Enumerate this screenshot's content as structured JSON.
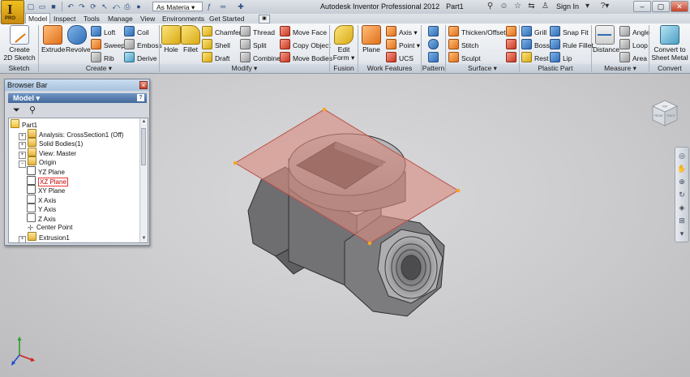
{
  "app": {
    "logo_text": "I",
    "logo_sub": "PRO",
    "title": "Autodesk Inventor Professional 2012",
    "document": "Part1",
    "material_dropdown": "As Materia",
    "sign_in": "Sign In"
  },
  "icons": {
    "qat": [
      "new-icon",
      "open-icon",
      "save-icon",
      "undo-icon",
      "redo-icon",
      "update-icon",
      "select-icon",
      "return-icon",
      "print-icon"
    ],
    "help": [
      "binoculars-icon",
      "people-icon",
      "star-icon",
      "exchange-icon",
      "help-icon"
    ]
  },
  "tabs": [
    "Model",
    "Inspect",
    "Tools",
    "Manage",
    "View",
    "Environments",
    "Get Started"
  ],
  "ribbon": {
    "panels": [
      "Sketch",
      "Create ▾",
      "Modify ▾",
      "Fusion",
      "Work Features",
      "Pattern",
      "Surface ▾",
      "Plastic Part",
      "Measure ▾",
      "Convert"
    ],
    "sketch": {
      "create_2d_sketch": "Create\n2D Sketch ▾"
    },
    "create": {
      "extrude": "Extrude",
      "revolve": "Revolve",
      "loft": "Loft",
      "sweep": "Sweep",
      "rib": "Rib",
      "coil": "Coil",
      "emboss": "Emboss",
      "derive": "Derive"
    },
    "modify": {
      "hole": "Hole",
      "fillet": "Fillet",
      "chamfer": "Chamfer",
      "shell": "Shell",
      "draft": "Draft",
      "thread": "Thread",
      "split": "Split",
      "combine": "Combine",
      "move_face": "Move Face",
      "copy_object": "Copy Object",
      "move_bodies": "Move Bodies"
    },
    "fusion": {
      "edit_form": "Edit\nForm ▾"
    },
    "work_features": {
      "plane": "Plane",
      "axis": "Axis ▾",
      "point": "Point ▾",
      "ucs": "UCS"
    },
    "surface": {
      "thicken_offset": "Thicken/Offset",
      "stitch": "Stitch",
      "sculpt": "Sculpt"
    },
    "plastic_part": {
      "grill": "Grill",
      "boss": "Boss",
      "rest": "Rest",
      "snap_fit": "Snap Fit",
      "rule_fillet": "Rule Fillet",
      "lip": "Lip"
    },
    "measure": {
      "distance": "Distance",
      "angle": "Angle",
      "loop": "Loop",
      "area": "Area"
    },
    "convert": {
      "sheet_metal": "Convert to\nSheet Metal"
    }
  },
  "browser": {
    "title": "Browser Bar",
    "close": "×",
    "model_dropdown": "Model ▾",
    "help": "?",
    "tree": [
      {
        "label": "Part1",
        "indent": 0,
        "icon": "part",
        "expander": ""
      },
      {
        "label": "Analysis: CrossSection1 (Off)",
        "indent": 1,
        "icon": "folder",
        "expander": "+"
      },
      {
        "label": "Solid Bodies(1)",
        "indent": 1,
        "icon": "folder",
        "expander": "+"
      },
      {
        "label": "View: Master",
        "indent": 1,
        "icon": "folder",
        "expander": "+"
      },
      {
        "label": "Origin",
        "indent": 1,
        "icon": "folder",
        "expander": "−"
      },
      {
        "label": "YZ Plane",
        "indent": 2,
        "icon": "plane",
        "expander": ""
      },
      {
        "label": "XZ Plane",
        "indent": 2,
        "icon": "plane",
        "expander": "",
        "highlight": true
      },
      {
        "label": "XY Plane",
        "indent": 2,
        "icon": "plane",
        "expander": ""
      },
      {
        "label": "X Axis",
        "indent": 2,
        "icon": "axis",
        "expander": ""
      },
      {
        "label": "Y Axis",
        "indent": 2,
        "icon": "axis",
        "expander": ""
      },
      {
        "label": "Z Axis",
        "indent": 2,
        "icon": "axis",
        "expander": ""
      },
      {
        "label": "Center Point",
        "indent": 2,
        "icon": "point",
        "expander": ""
      },
      {
        "label": "Extrusion1",
        "indent": 1,
        "icon": "folder",
        "expander": "+"
      }
    ]
  },
  "viewcube": {
    "front": "FRONT",
    "right": "RIGHT",
    "top": "TOP"
  },
  "colors": {
    "plane_fill": "#d88a80",
    "plane_edge": "#b85048",
    "body": "#7f7f82",
    "accent": "#2f6db4"
  }
}
